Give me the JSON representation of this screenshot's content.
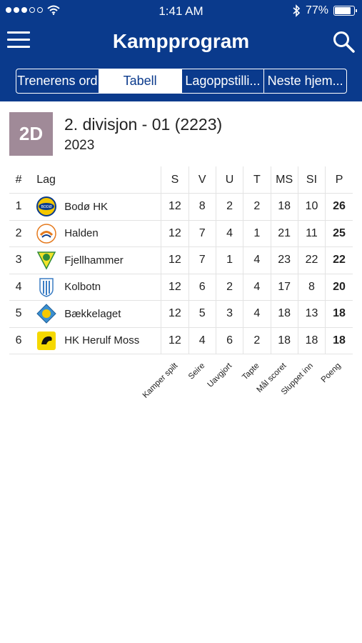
{
  "status": {
    "time": "1:41 AM",
    "battery": "77%",
    "battery_fraction": 0.77,
    "signal_dots": 5,
    "signal_filled": 3
  },
  "header": {
    "title": "Kampprogram",
    "background_color": "#0a3a8c"
  },
  "tabs": [
    {
      "label": "Trenerens ord",
      "active": false
    },
    {
      "label": "Tabell",
      "active": true
    },
    {
      "label": "Lagoppstilli...",
      "active": false
    },
    {
      "label": "Neste hjem...",
      "active": false
    }
  ],
  "league": {
    "badge": "2D",
    "badge_color": "#a08a98",
    "name": "2. divisjon - 01 (2223)",
    "year": "2023"
  },
  "table": {
    "headers": {
      "rank": "#",
      "team": "Lag",
      "S": "S",
      "V": "V",
      "U": "U",
      "T": "T",
      "MS": "MS",
      "SI": "SI",
      "P": "P"
    },
    "rows": [
      {
        "rank": "1",
        "team": "Bodø HK",
        "logo": "bodo-hk-logo",
        "S": "12",
        "V": "8",
        "U": "2",
        "T": "2",
        "MS": "18",
        "SI": "10",
        "P": "26"
      },
      {
        "rank": "2",
        "team": "Halden",
        "logo": "halden-logo",
        "S": "12",
        "V": "7",
        "U": "4",
        "T": "1",
        "MS": "21",
        "SI": "11",
        "P": "25"
      },
      {
        "rank": "3",
        "team": "Fjellhammer",
        "logo": "fjellhammer-logo",
        "S": "12",
        "V": "7",
        "U": "1",
        "T": "4",
        "MS": "23",
        "SI": "22",
        "P": "22"
      },
      {
        "rank": "4",
        "team": "Kolbotn",
        "logo": "kolbotn-logo",
        "S": "12",
        "V": "6",
        "U": "2",
        "T": "4",
        "MS": "17",
        "SI": "8",
        "P": "20"
      },
      {
        "rank": "5",
        "team": "Bækkelaget",
        "logo": "baekkelaget-logo",
        "S": "12",
        "V": "5",
        "U": "3",
        "T": "4",
        "MS": "18",
        "SI": "13",
        "P": "18"
      },
      {
        "rank": "6",
        "team": "HK Herulf Moss",
        "logo": "herulf-moss-logo",
        "S": "12",
        "V": "4",
        "U": "6",
        "T": "2",
        "MS": "18",
        "SI": "18",
        "P": "18"
      }
    ],
    "column_legend": [
      "Kamper spilt",
      "Seire",
      "Uavgjort",
      "Tapte",
      "Mål scoret",
      "Sluppet inn",
      "Poeng"
    ]
  }
}
